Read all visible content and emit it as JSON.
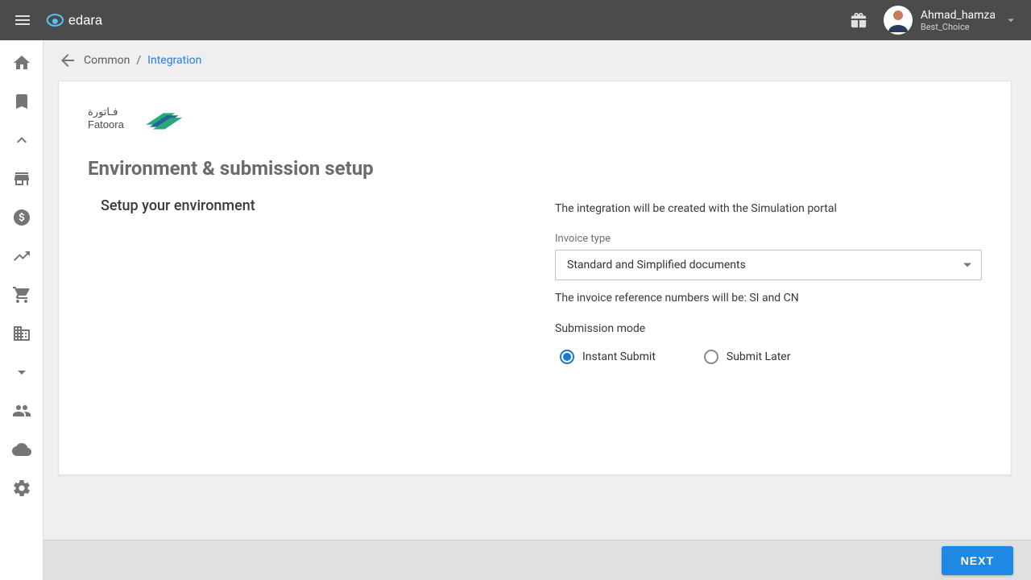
{
  "header": {
    "brand": "edara",
    "user_name": "Ahmad_hamza",
    "company": "Best_Choice"
  },
  "sidebar": {
    "icons": [
      "home",
      "bookmark",
      "expand_less",
      "store",
      "paid",
      "trending_up",
      "shopping_cart",
      "business",
      "expand_more",
      "group",
      "cloud",
      "settings"
    ]
  },
  "breadcrumb": {
    "parent": "Common",
    "separator": " / ",
    "current": "Integration"
  },
  "card": {
    "section_title": "Environment & submission setup",
    "left_heading": "Setup your environment",
    "info_line": "The integration will be created with the Simulation portal",
    "invoice_type_label": "Invoice type",
    "invoice_type_value": "Standard and Simplified documents",
    "reference_line": "The invoice reference numbers will be: SI and CN",
    "submission_mode_label": "Submission mode",
    "radio_instant": "Instant Submit",
    "radio_later": "Submit Later",
    "selected_submission": "instant"
  },
  "footer": {
    "next": "NEXT"
  },
  "colors": {
    "primary": "#1e88e5",
    "link": "#2a7edb",
    "text_muted": "#6b6b6b"
  }
}
